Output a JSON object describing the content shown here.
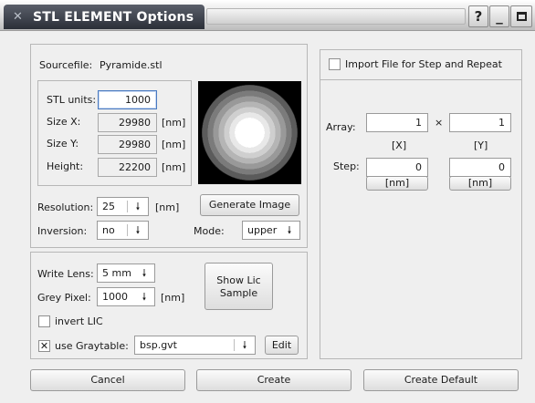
{
  "window": {
    "title": "STL ELEMENT Options",
    "help_button": "?",
    "minimize_button": "_",
    "maximize_button": "□",
    "close_button": "X"
  },
  "source": {
    "sourcefile_label": "Sourcefile:",
    "sourcefile_value": "Pyramide.stl",
    "stl_units_label": "STL units:",
    "stl_units_value": "1000",
    "size_x_label": "Size X:",
    "size_x_value": "29980",
    "size_y_label": "Size Y:",
    "size_y_value": "29980",
    "height_label": "Height:",
    "height_value": "22200",
    "unit_nm": "[nm]",
    "resolution_label": "Resolution:",
    "resolution_value": "25",
    "inversion_label": "Inversion:",
    "inversion_value": "no",
    "generate_button": "Generate Image",
    "mode_label": "Mode:",
    "mode_value": "upper"
  },
  "lens": {
    "write_lens_label": "Write Lens:",
    "write_lens_value": "5 mm",
    "grey_pixel_label": "Grey Pixel:",
    "grey_pixel_value": "1000",
    "show_lic_line1": "Show Lic",
    "show_lic_line2": "Sample",
    "invert_lic_label": "invert LIC",
    "invert_lic_checked": false,
    "use_graytable_label": "use Graytable:",
    "use_graytable_checked": true,
    "graytable_value": "bsp.gvt",
    "edit_button": "Edit"
  },
  "step_repeat": {
    "import_label": "Import File for Step and Repeat",
    "import_checked": false,
    "array_label": "Array:",
    "array_x": "1",
    "times": "×",
    "array_y": "1",
    "x_label": "[X]",
    "y_label": "[Y]",
    "step_label": "Step:",
    "step_x": "0",
    "step_y": "0",
    "step_x_unit": "[nm]",
    "step_y_unit": "[nm]"
  },
  "footer": {
    "cancel": "Cancel",
    "create": "Create",
    "create_default": "Create Default"
  },
  "icons": {
    "window_icon": "stl-icon",
    "combo_arrow": "down-arrow-icon"
  }
}
